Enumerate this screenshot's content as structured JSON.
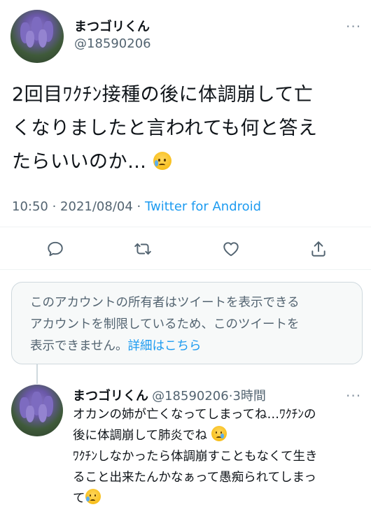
{
  "main_tweet": {
    "display_name": "まつゴリくん",
    "handle": "@18590206",
    "text_lines": [
      "2回目ﾜｸﾁﾝ接種の後に体調崩して亡",
      "くなりましたと言われても何と答え",
      "たらいいのか…"
    ],
    "time": "10:50",
    "date": "2021/08/04",
    "source": "Twitter for Android",
    "more_icon": "more-horizontal-icon"
  },
  "actions": [
    {
      "icon": "reply-icon"
    },
    {
      "icon": "retweet-icon"
    },
    {
      "icon": "like-icon"
    },
    {
      "icon": "share-icon"
    }
  ],
  "notice": {
    "text_lines": [
      "このアカウントの所有者はツイートを表示できる",
      "アカウントを制限しているため、このツイートを",
      "表示できません。"
    ],
    "link": "詳細はこちら"
  },
  "reply_tweet": {
    "display_name": "まつゴリくん",
    "handle": "@18590206",
    "time_ago": "3時間",
    "text_lines": [
      "オカンの姉が亡くなってしまってね…ﾜｸﾁﾝの",
      "後に体調崩して肺炎でね",
      "ﾜｸﾁﾝしなかったら体調崩すこともなくて生き",
      "ること出来たんかなぁって愚痴られてしまっ",
      "て"
    ]
  },
  "colors": {
    "text": "#0f1419",
    "secondary": "#536471",
    "link": "#1d9bf0",
    "border": "#cfd9de"
  }
}
